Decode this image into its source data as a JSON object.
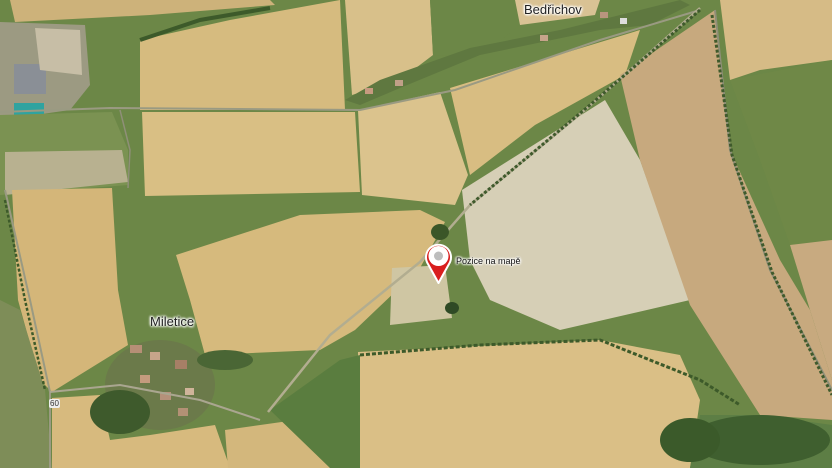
{
  "map": {
    "places": {
      "bedrichov": "Bedřichov",
      "miletice": "Miletice"
    },
    "pin": {
      "label": "Pozice na mapě",
      "icon": "map-pin-icon",
      "color": "#d91e1e"
    },
    "road_marker": "60"
  }
}
